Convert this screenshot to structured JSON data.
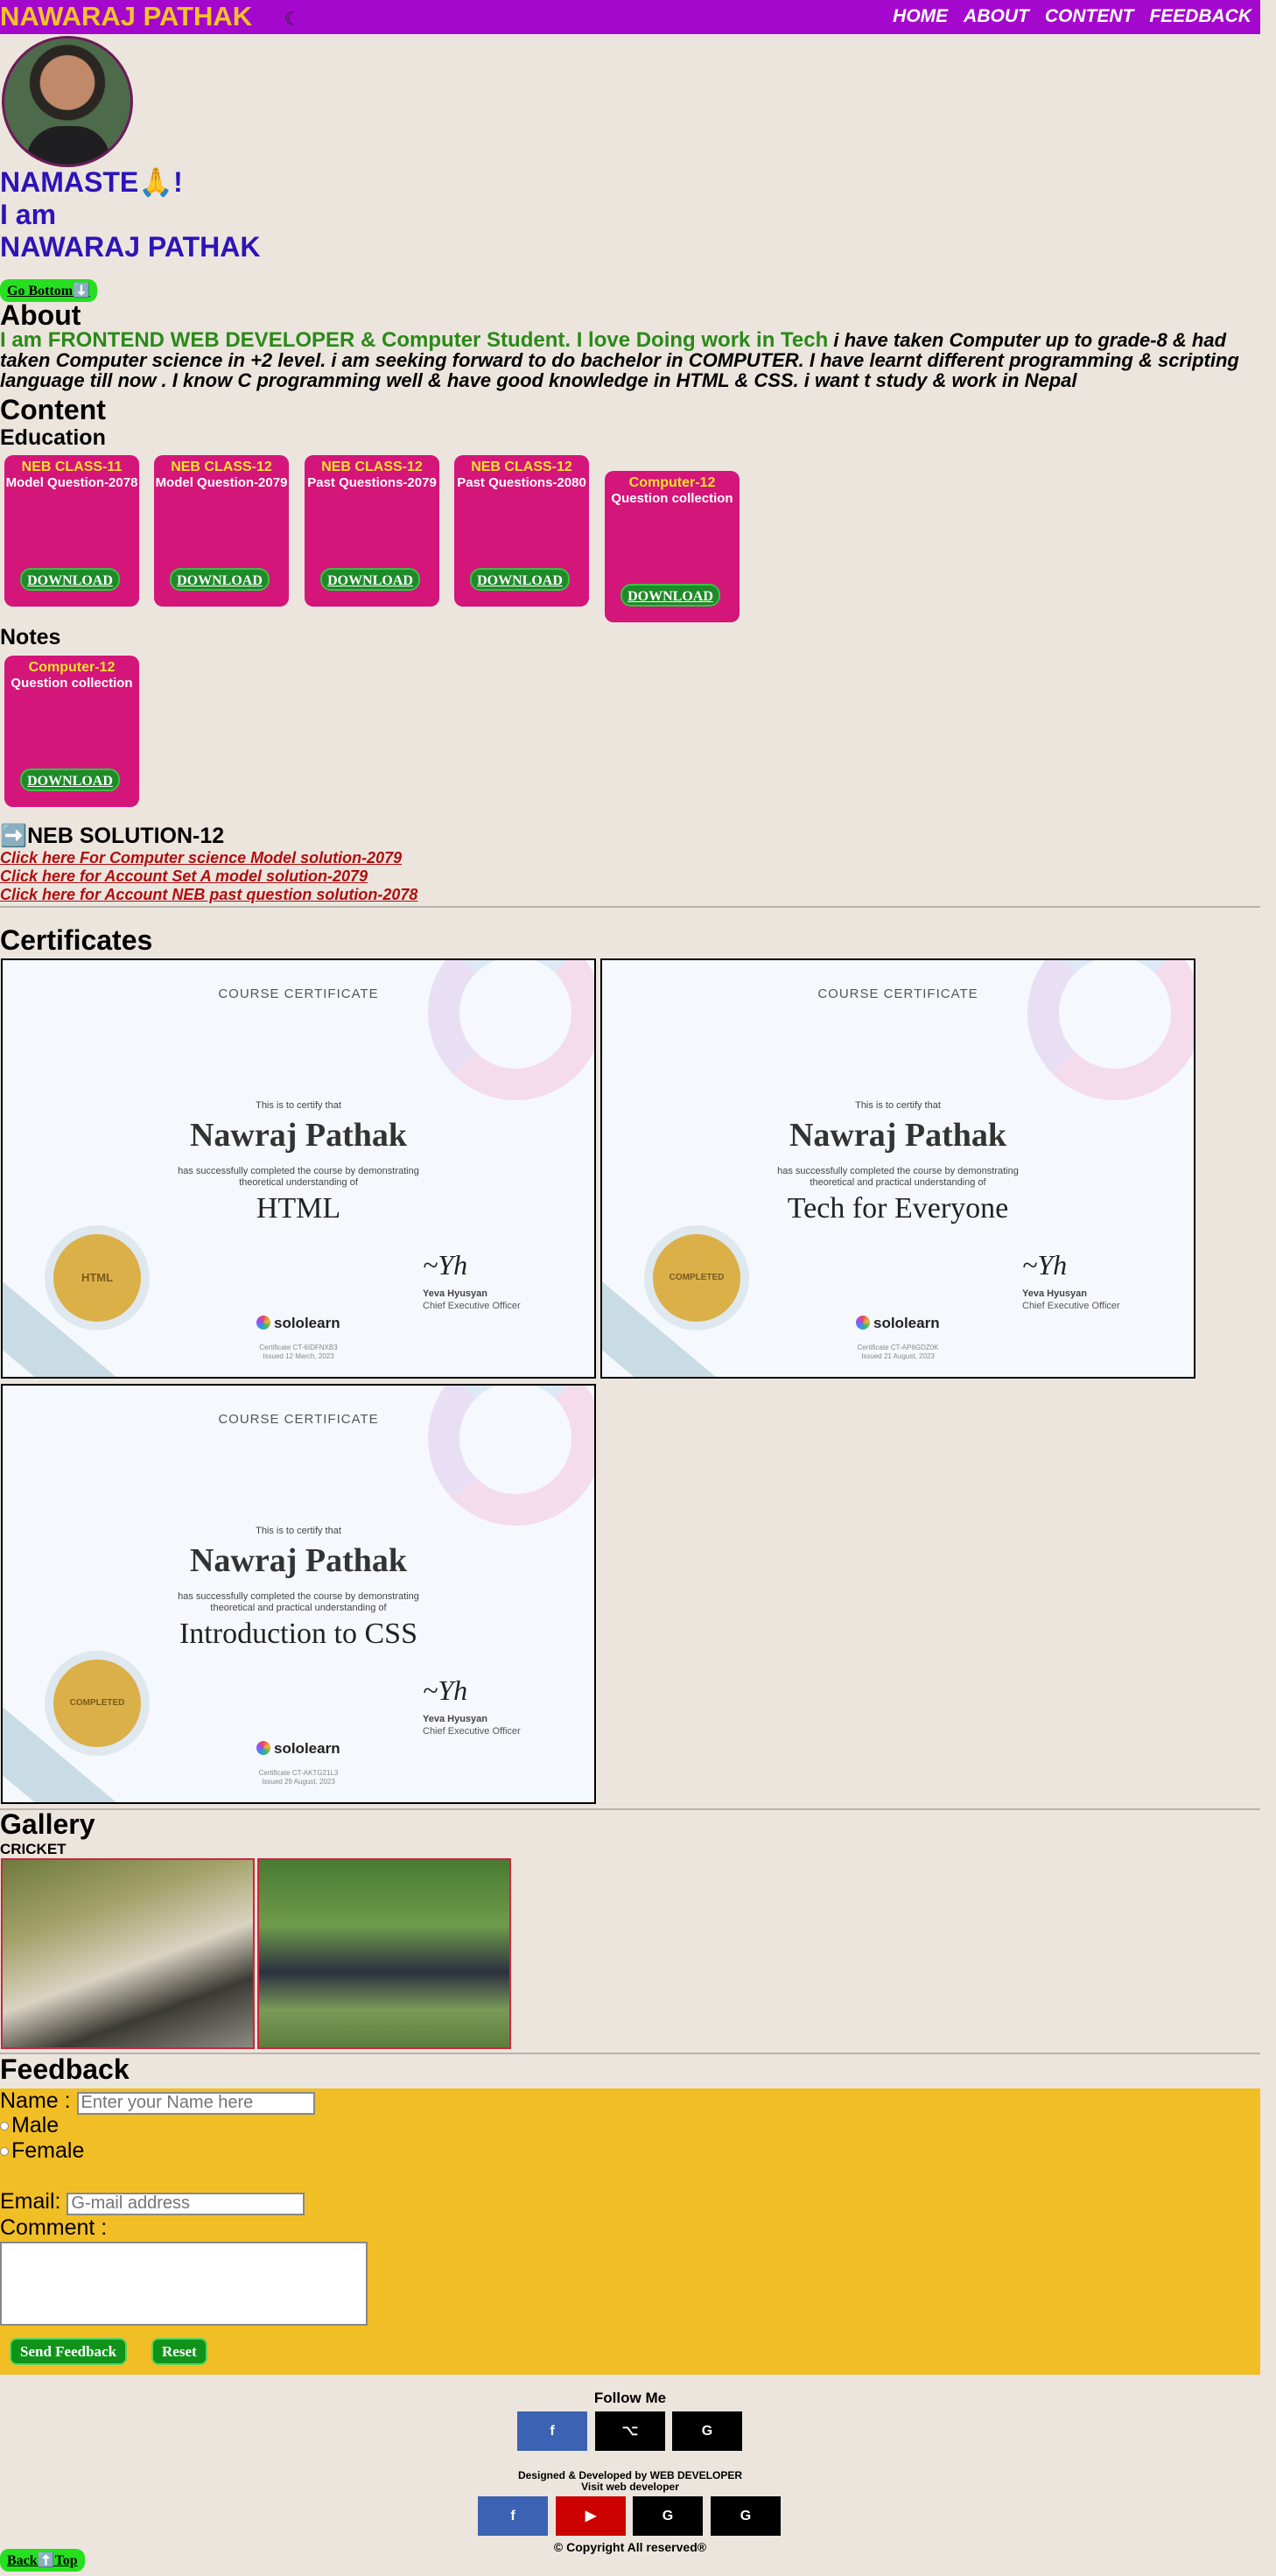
{
  "nav": {
    "brand": "NAWARAJ PATHAK",
    "theme_icon": "☾",
    "links": [
      "HOME",
      "ABOUT",
      "CONTENT",
      "FEEDBACK"
    ]
  },
  "hero": {
    "greeting": "NAMASTE🙏!",
    "line2": "I am",
    "name": "NAWARAJ PATHAK",
    "go_bottom": "Go Bottom⬇️"
  },
  "about": {
    "heading": "About",
    "highlight": "I am FRONTEND WEB DEVELOPER & Computer Student. I love Doing work in Tech",
    "text": "i have taken Computer up to grade-8 & had taken Computer science in +2 level. i am seeking forward to do bachelor in COMPUTER. I have learnt different programming & scripting language till now . I know C programming well & have good knowledge in HTML & CSS. i want t study & work in Nepal"
  },
  "content": {
    "heading": "Content",
    "education_heading": "Education",
    "education_cards": [
      {
        "title": "NEB CLASS-11",
        "sub": "Model Question-2078",
        "button": "DOWNLOAD"
      },
      {
        "title": "NEB CLASS-12",
        "sub": "Model Question-2079",
        "button": "DOWNLOAD"
      },
      {
        "title": "NEB CLASS-12",
        "sub": "Past Questions-2079",
        "button": "DOWNLOAD"
      },
      {
        "title": "NEB CLASS-12",
        "sub": "Past Questions-2080",
        "button": "DOWNLOAD"
      },
      {
        "title": "Computer-12",
        "sub": "Question collection",
        "button": "DOWNLOAD"
      }
    ],
    "notes_heading": "Notes",
    "notes_cards": [
      {
        "title": "Computer-12",
        "sub": "Question collection",
        "button": "DOWNLOAD"
      }
    ],
    "neb_heading": "➡️NEB SOLUTION-12",
    "neb_links": [
      "Click here For Computer science Model solution-2079",
      "Click here for Account Set A model solution-2079",
      "Click here for Account NEB past question solution-2078"
    ]
  },
  "certificates": {
    "heading": "Certificates",
    "items": [
      {
        "header": "COURSE CERTIFICATE",
        "certify": "This is to certify that",
        "name": "Nawraj Pathak",
        "desc1": "has successfully completed the course by demonstrating",
        "desc2": "theoretical understanding of",
        "course": "HTML",
        "seal": "HTML",
        "signer": "Yeva Hyusyan",
        "role": "Chief Executive Officer",
        "logo": "sololearn",
        "cert_id": "Certificate CT-6IDFNXB3",
        "issued": "Issued 12 March, 2023"
      },
      {
        "header": "COURSE CERTIFICATE",
        "certify": "This is to certify that",
        "name": "Nawraj Pathak",
        "desc1": "has successfully completed the course by demonstrating",
        "desc2": "theoretical and practical understanding of",
        "course": "Tech for Everyone",
        "seal": "COMPLETED",
        "signer": "Yeva Hyusyan",
        "role": "Chief Executive Officer",
        "logo": "sololearn",
        "cert_id": "Certificate CT-AP6GDZ0K",
        "issued": "Issued 21 August, 2023"
      },
      {
        "header": "COURSE CERTIFICATE",
        "certify": "This is to certify that",
        "name": "Nawraj Pathak",
        "desc1": "has successfully completed the course by demonstrating",
        "desc2": "theoretical and practical understanding of",
        "course": "Introduction to CSS",
        "seal": "COMPLETED",
        "signer": "Yeva Hyusyan",
        "role": "Chief Executive Officer",
        "logo": "sololearn",
        "cert_id": "Certificate CT-AKTG21L3",
        "issued": "Issued 29 August, 2023"
      }
    ]
  },
  "gallery": {
    "heading": "Gallery",
    "caption": "CRICKET"
  },
  "feedback": {
    "heading": "Feedback",
    "name_label": "Name :",
    "name_placeholder": "Enter your Name here",
    "gender_options": [
      "Male",
      "Female"
    ],
    "email_label": "Email:",
    "email_placeholder": "G-mail address",
    "comment_label": "Comment :",
    "send": "Send Feedback",
    "reset": "Reset"
  },
  "footer": {
    "follow": "Follow Me",
    "follow_icons": [
      "f",
      "⌥",
      "G"
    ],
    "designed": "Designed & Developed by WEB DEVELOPER",
    "visit": "Visit web developer",
    "visit_icons": [
      "f",
      "▶",
      "G",
      "G"
    ],
    "copyright": "© Copyright All reserved®",
    "back_top": "Back⬆️Top"
  },
  "colors": {
    "nav": "#a408cc",
    "brand": "#f3c226",
    "card": "#d4157a",
    "form": "#f2be25",
    "accent_green": "#26e01f"
  }
}
